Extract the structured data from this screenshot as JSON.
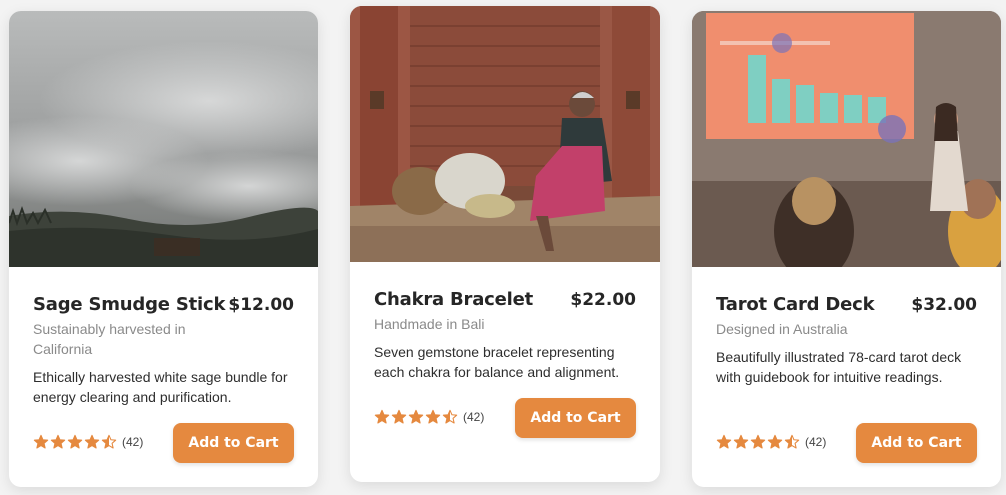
{
  "colors": {
    "accent": "#e5893f",
    "star": "#e5893f"
  },
  "products": [
    {
      "name": "Sage Smudge Stick",
      "price": "$12.00",
      "origin": "Sustainably harvested in California",
      "description": "Ethically harvested white sage bundle for energy clearing and purification.",
      "rating": 4.5,
      "review_count": "(42)",
      "button_label": "Add to Cart",
      "image": "misty-field-photo"
    },
    {
      "name": "Chakra Bracelet",
      "price": "$22.00",
      "origin": "Handmade in Bali",
      "description": "Seven gemstone bracelet representing each chakra for balance and alignment.",
      "rating": 4.5,
      "review_count": "(42)",
      "button_label": "Add to Cart",
      "image": "woman-seated-brick-doorway-photo"
    },
    {
      "name": "Tarot Card Deck",
      "price": "$32.00",
      "origin": "Designed in Australia",
      "description": "Beautifully illustrated 78-card tarot deck with guidebook for intuitive readings.",
      "rating": 4.5,
      "review_count": "(42)",
      "button_label": "Add to Cart",
      "image": "presentation-room-photo"
    }
  ]
}
